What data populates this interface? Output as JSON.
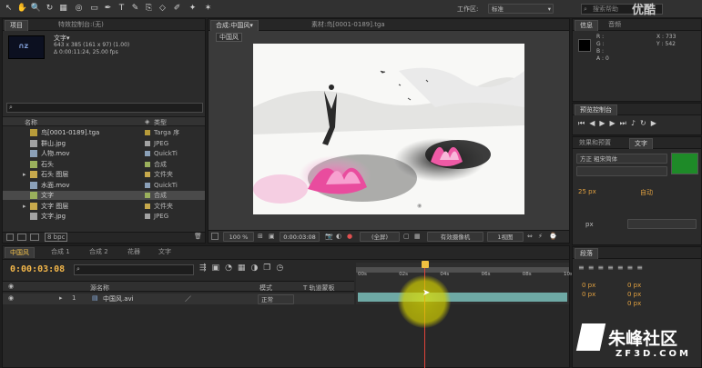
{
  "toolbar": {
    "workspace_label": "工作区:",
    "workspace_value": "标准",
    "search_placeholder": "搜索帮助"
  },
  "project": {
    "tabs": [
      {
        "label": "项目"
      },
      {
        "label": "特效控制台:(无)"
      }
    ],
    "selected": {
      "name": "文字▾",
      "dimensions": "643 x 385 (161 x 97) (1.00)",
      "duration": "Δ 0:00:11:24, 25.00 fps"
    },
    "columns": {
      "name": "名称",
      "type": "类型"
    },
    "items": [
      {
        "name": "鸟[0001-0189].tga",
        "type": "Targa 序",
        "color": "#b79b3a"
      },
      {
        "name": "群山.jpg",
        "type": "JPEG",
        "color": "#a2a2a2"
      },
      {
        "name": "人物.mov",
        "type": "QuickTi",
        "color": "#8ba0b8"
      },
      {
        "name": "石头",
        "type": "合成",
        "color": "#9ab05c"
      },
      {
        "name": "石头 图层",
        "type": "文件夹",
        "color": "#c7a94c"
      },
      {
        "name": "水面.mov",
        "type": "QuickTi",
        "color": "#8ba0b8"
      },
      {
        "name": "文字",
        "type": "合成",
        "color": "#9ab05c"
      },
      {
        "name": "文字 图层",
        "type": "文件夹",
        "color": "#c7a94c"
      },
      {
        "name": "文字.jpg",
        "type": "JPEG",
        "color": "#a2a2a2"
      }
    ],
    "bpc": "8 bpc"
  },
  "composition": {
    "tab_comp": "合成:中国风▾",
    "tab_footage": "素材:鸟[0001-0189].tga",
    "breadcrumb": "中国风",
    "zoom": "100 %",
    "time": "0:00:03:08",
    "resolution": "(全屏)",
    "camera": "有效摄像机",
    "views": "1视图"
  },
  "info": {
    "tabs": [
      {
        "label": "信息"
      },
      {
        "label": "音频"
      }
    ],
    "channels": [
      "R :",
      "G :",
      "B :",
      "A : 0"
    ],
    "x": "X : 733",
    "y": "Y : 542"
  },
  "preview": {
    "title": "预览控制台"
  },
  "effects": {
    "tabs": [
      {
        "label": "效果和预置"
      },
      {
        "label": "文字"
      }
    ],
    "font": "方正 粗宋简体",
    "size": "25 px",
    "tracking": "自动",
    "unit": "px"
  },
  "paragraph": {
    "title": "段落",
    "values": [
      "0 px",
      "0 px",
      "0 px",
      "0 px",
      "0 px"
    ]
  },
  "timeline": {
    "tabs": [
      {
        "label": "中国风"
      },
      {
        "label": "合成 1"
      },
      {
        "label": "合成 2"
      },
      {
        "label": "花器"
      },
      {
        "label": "文字"
      }
    ],
    "current_time": "0:00:03:08",
    "search_placeholder": "",
    "ruler": [
      "00s",
      "02s",
      "04s",
      "06s",
      "08s",
      "10s"
    ],
    "columns": {
      "name": "源名称",
      "mode": "模式",
      "trkmat": "T 轨道蒙板"
    },
    "layers": [
      {
        "index": "1",
        "name": "中国风.avi",
        "mode": "正常"
      }
    ]
  },
  "watermark": {
    "top": "优酷",
    "brand": "朱峰社区",
    "url": "ZF3D.COM"
  }
}
